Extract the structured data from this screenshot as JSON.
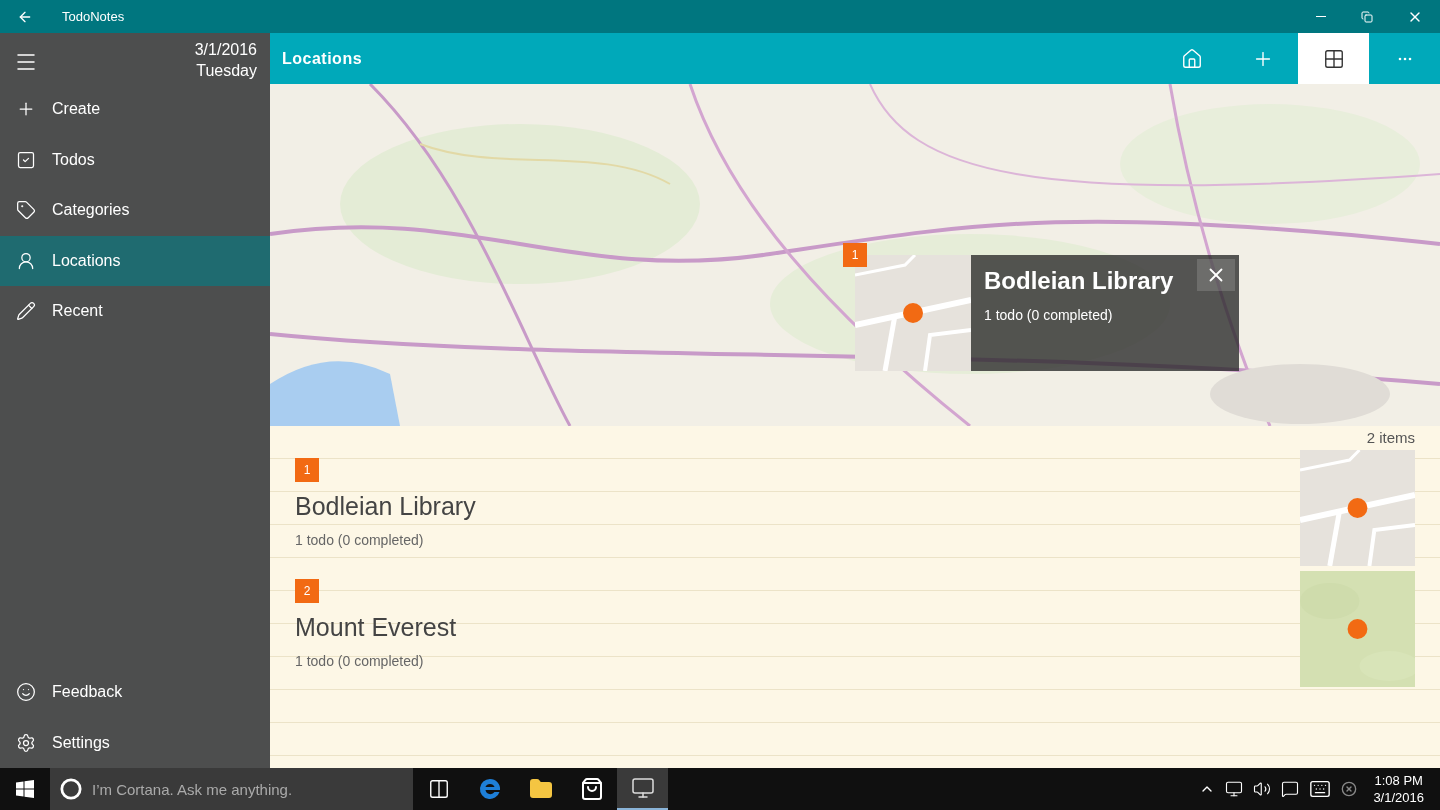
{
  "window": {
    "title": "TodoNotes"
  },
  "sidebar": {
    "date": "3/1/2016",
    "weekday": "Tuesday",
    "items": [
      {
        "label": "Create",
        "kind": "plus",
        "selected": false
      },
      {
        "label": "Todos",
        "kind": "check",
        "selected": false
      },
      {
        "label": "Categories",
        "kind": "tag",
        "selected": false
      },
      {
        "label": "Locations",
        "kind": "person",
        "selected": true
      },
      {
        "label": "Recent",
        "kind": "pencil",
        "selected": false
      }
    ],
    "footer_items": [
      {
        "label": "Feedback",
        "kind": "smile"
      },
      {
        "label": "Settings",
        "kind": "gear"
      }
    ]
  },
  "header": {
    "title": "Locations",
    "actions": [
      {
        "kind": "home",
        "selected": false
      },
      {
        "kind": "plus",
        "selected": false
      },
      {
        "kind": "grid",
        "selected": true
      },
      {
        "kind": "more",
        "selected": false
      }
    ]
  },
  "map": {
    "popup": {
      "number": "1",
      "title": "Bodleian Library",
      "summary": "1 todo (0 completed)"
    }
  },
  "list": {
    "count": "2 items",
    "items": [
      {
        "number": "1",
        "title": "Bodleian Library",
        "summary": "1 todo (0 completed)",
        "kind": "street"
      },
      {
        "number": "2",
        "title": "Mount Everest",
        "summary": "1 todo (0 completed)",
        "kind": "terrain"
      }
    ]
  },
  "taskbar": {
    "search_placeholder": "I’m Cortana. Ask me anything.",
    "apps": [
      {
        "kind": "task-view",
        "selected": false
      },
      {
        "kind": "browser",
        "selected": false
      },
      {
        "kind": "folder",
        "selected": false
      },
      {
        "kind": "store",
        "selected": false
      },
      {
        "kind": "app",
        "selected": true
      }
    ],
    "clock": {
      "time": "1:08 PM",
      "date": "3/1/2016"
    }
  }
}
